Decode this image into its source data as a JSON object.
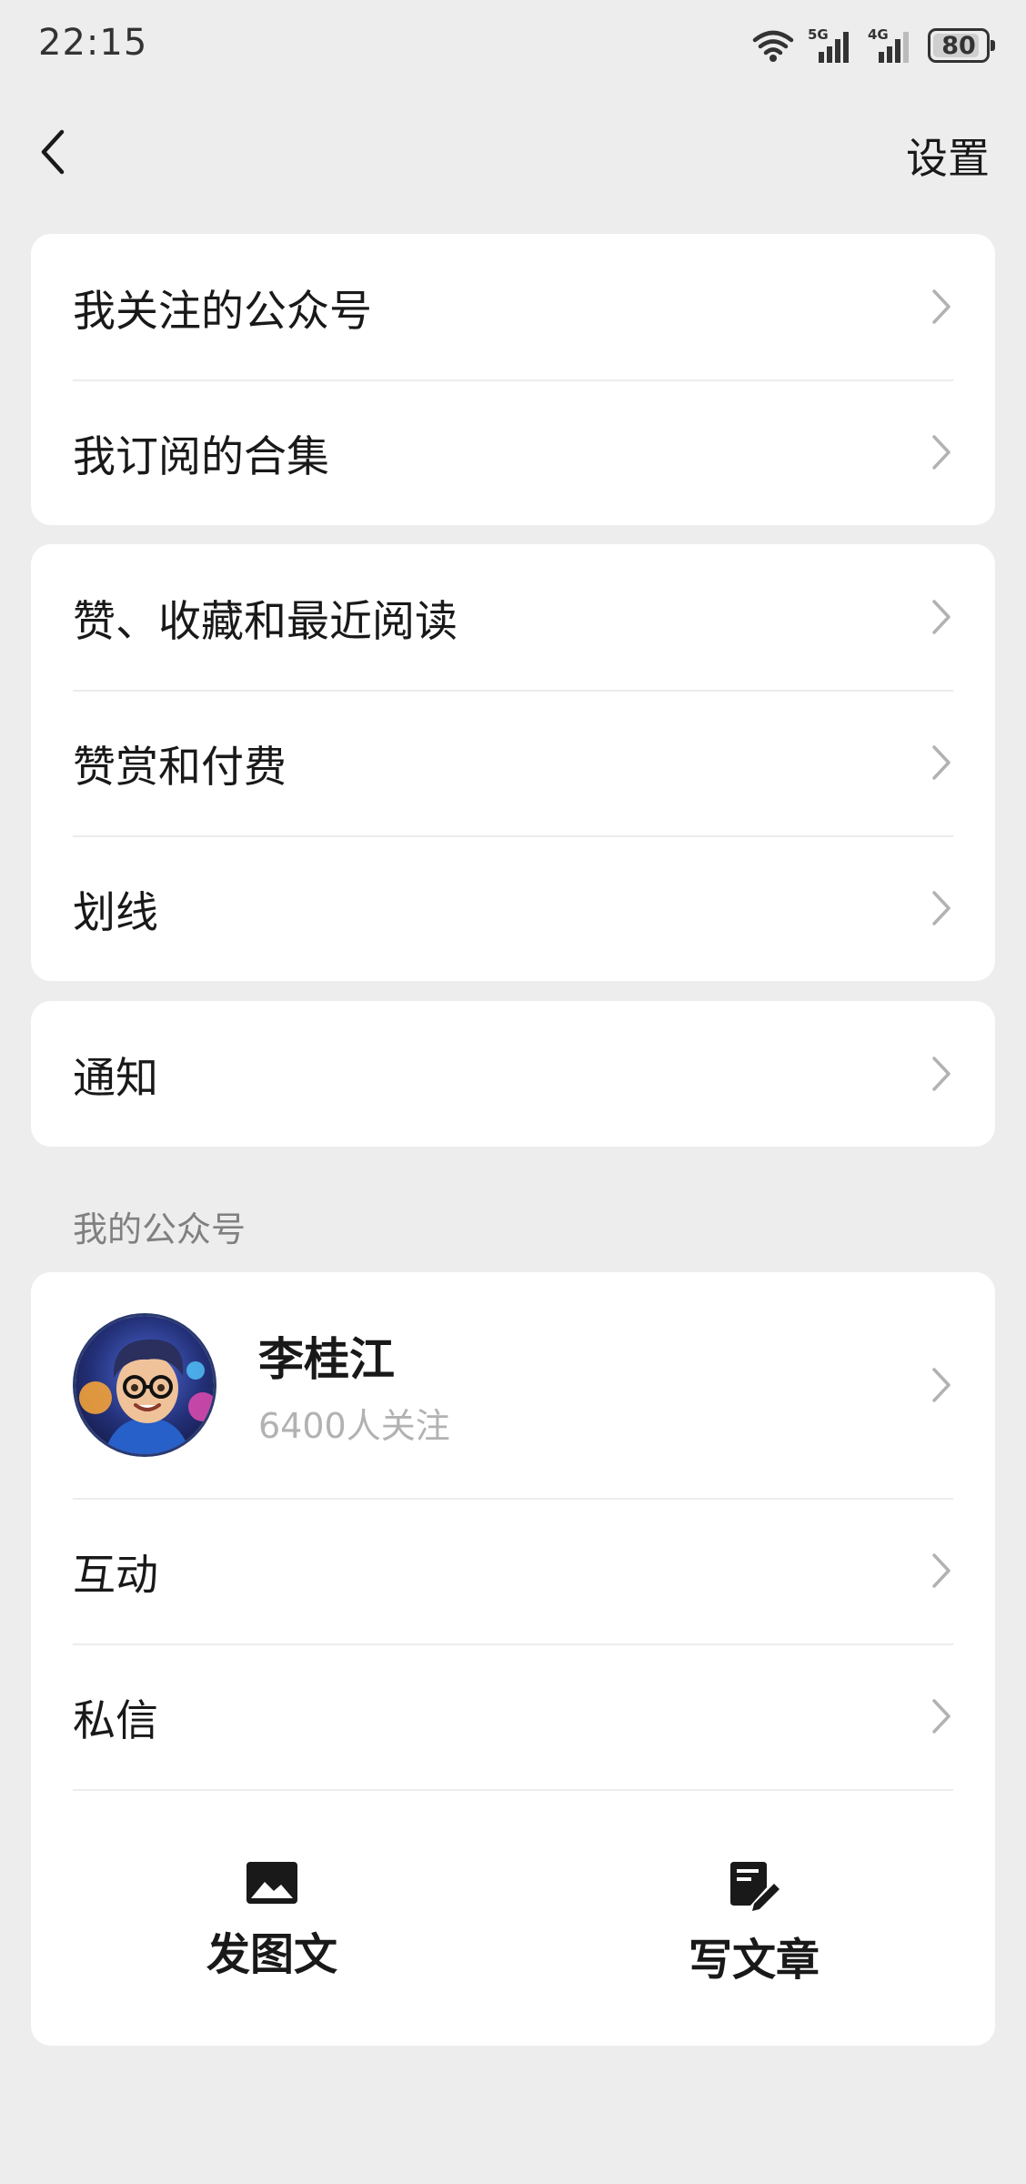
{
  "status_bar": {
    "time": "22:15",
    "battery_level": "80",
    "network_labels": [
      "5G",
      "4G"
    ],
    "icons": [
      "wifi-icon",
      "signal-5g-icon",
      "signal-4g-icon",
      "battery-icon"
    ]
  },
  "nav": {
    "back_icon": "chevron-left-icon",
    "settings_label": "设置"
  },
  "groups": [
    {
      "items": [
        {
          "label": "我关注的公众号"
        },
        {
          "label": "我订阅的合集"
        }
      ]
    },
    {
      "items": [
        {
          "label": "赞、收藏和最近阅读"
        },
        {
          "label": "赞赏和付费"
        },
        {
          "label": "划线"
        }
      ]
    },
    {
      "items": [
        {
          "label": "通知"
        }
      ]
    }
  ],
  "my_account": {
    "section_title": "我的公众号",
    "name": "李桂江",
    "followers": "6400人关注",
    "items": [
      {
        "label": "互动"
      },
      {
        "label": "私信"
      }
    ],
    "actions": [
      {
        "label": "发图文",
        "icon": "image-icon"
      },
      {
        "label": "写文章",
        "icon": "edit-document-icon"
      }
    ]
  },
  "colors": {
    "background": "#ededed",
    "card": "#ffffff",
    "text_primary": "#191919",
    "text_secondary": "#808080",
    "text_muted": "#b2b2b2",
    "chevron": "#b2b2b2"
  }
}
